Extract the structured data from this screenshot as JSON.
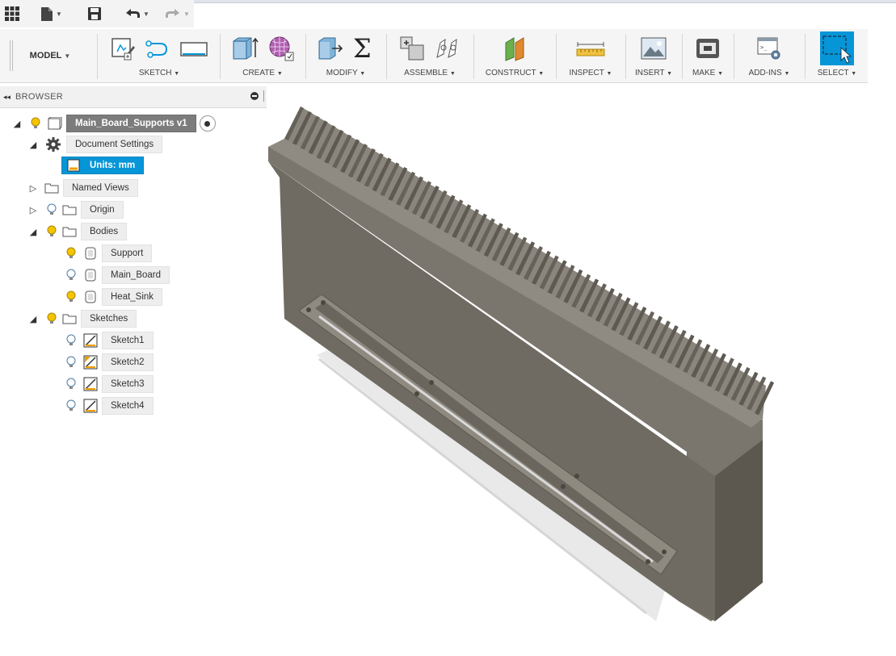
{
  "quick_access": {
    "grid_icon": "app-grid-icon",
    "file_icon": "file-icon",
    "save_icon": "save-icon",
    "undo_icon": "undo-icon",
    "redo_icon": "redo-icon"
  },
  "toolbar": {
    "workspace": "MODEL",
    "groups": [
      {
        "label": "SKETCH"
      },
      {
        "label": "CREATE"
      },
      {
        "label": "MODIFY"
      },
      {
        "label": "ASSEMBLE"
      },
      {
        "label": "CONSTRUCT"
      },
      {
        "label": "INSPECT"
      },
      {
        "label": "INSERT"
      },
      {
        "label": "MAKE"
      },
      {
        "label": "ADD-INS"
      },
      {
        "label": "SELECT"
      }
    ],
    "dropdown_glyph": "▼"
  },
  "browser": {
    "title": "BROWSER",
    "collapse_glyph": "◂◂",
    "root": "Main_Board_Supports v1",
    "document_settings": "Document Settings",
    "units": "Units: mm",
    "named_views": "Named Views",
    "origin": "Origin",
    "bodies": "Bodies",
    "body_items": [
      "Support",
      "Main_Board",
      "Heat_Sink"
    ],
    "sketches": "Sketches",
    "sketch_items": [
      "Sketch1",
      "Sketch2",
      "Sketch3",
      "Sketch4"
    ]
  },
  "colors": {
    "accent": "#0696d7",
    "root_node": "#7c7c7c",
    "bulb": "#f5c400",
    "heatsink": "#6f6b62"
  }
}
